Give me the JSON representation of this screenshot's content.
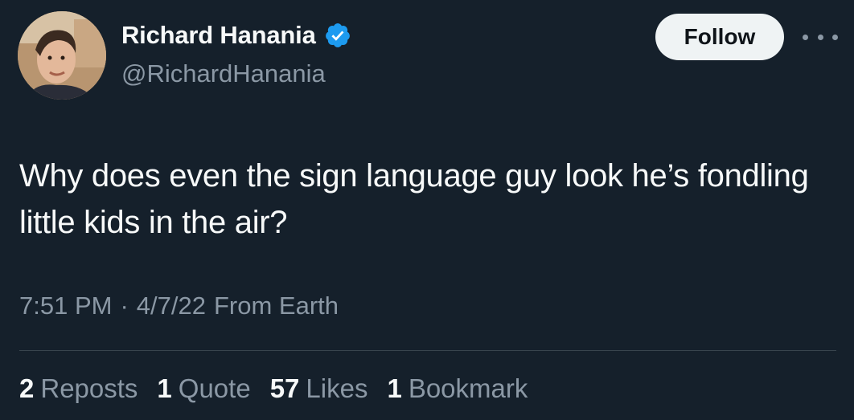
{
  "author": {
    "display_name": "Richard Hanania",
    "handle": "@RichardHanania",
    "verified": true,
    "avatar_icon": "profile-photo"
  },
  "follow_button": {
    "label": "Follow"
  },
  "more_icon": "more-options-icon",
  "tweet": {
    "text": "Why does even the sign language guy look he’s fondling little kids in the air?"
  },
  "meta": {
    "time": "7:51 PM",
    "separator": "·",
    "date": "4/7/22",
    "source": "From Earth"
  },
  "stats": {
    "reposts": {
      "count": "2",
      "label": "Reposts"
    },
    "quotes": {
      "count": "1",
      "label": "Quote"
    },
    "likes": {
      "count": "57",
      "label": "Likes"
    },
    "bookmarks": {
      "count": "1",
      "label": "Bookmark"
    }
  },
  "colors": {
    "background": "#15202b",
    "primary_text": "#f7f9f9",
    "secondary_text": "#8b98a5",
    "verified_blue": "#1d9bf0",
    "follow_bg": "#eff3f4"
  }
}
